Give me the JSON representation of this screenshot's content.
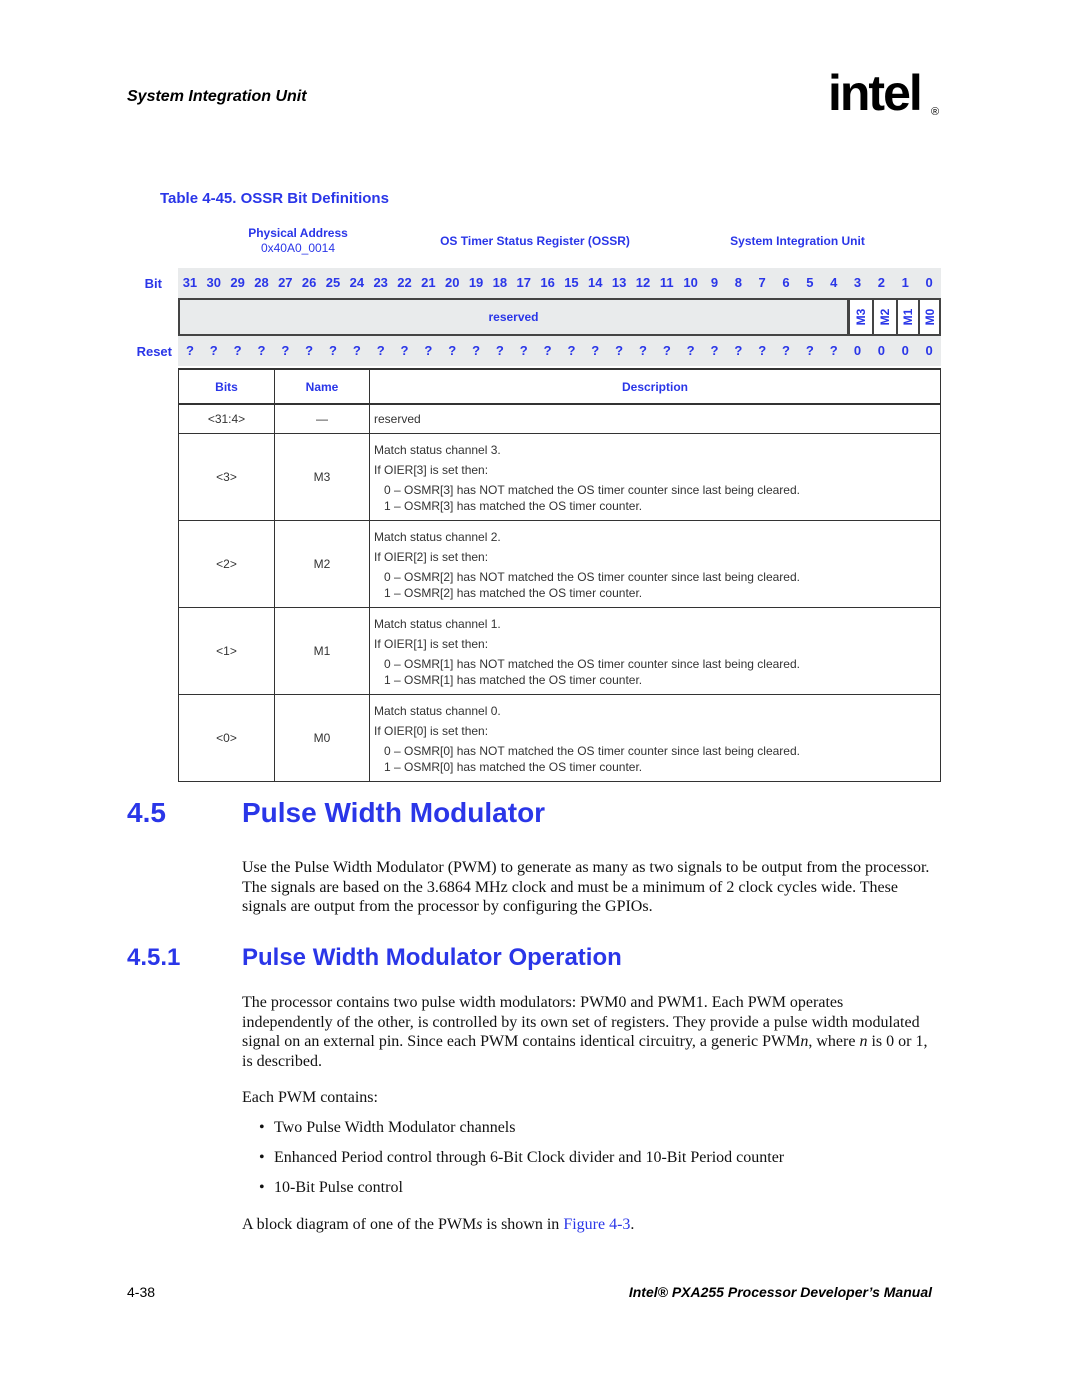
{
  "header": {
    "running_title": "System Integration Unit",
    "logo_text": "intel",
    "logo_mark": "®"
  },
  "table": {
    "caption": "Table 4-45. OSSR Bit Definitions",
    "physical_address_label": "Physical Address",
    "physical_address": "0x40A0_0014",
    "register_name": "OS Timer Status Register (OSSR)",
    "unit_name": "System Integration Unit",
    "bit_label": "Bit",
    "reset_label": "Reset",
    "bits": [
      "31",
      "30",
      "29",
      "28",
      "27",
      "26",
      "25",
      "24",
      "23",
      "22",
      "21",
      "20",
      "19",
      "18",
      "17",
      "16",
      "15",
      "14",
      "13",
      "12",
      "11",
      "10",
      "9",
      "8",
      "7",
      "6",
      "5",
      "4",
      "3",
      "2",
      "1",
      "0"
    ],
    "fields": {
      "reserved": "reserved",
      "m3": "M3",
      "m2": "M2",
      "m1": "M1",
      "m0": "M0"
    },
    "reset_values": [
      "?",
      "?",
      "?",
      "?",
      "?",
      "?",
      "?",
      "?",
      "?",
      "?",
      "?",
      "?",
      "?",
      "?",
      "?",
      "?",
      "?",
      "?",
      "?",
      "?",
      "?",
      "?",
      "?",
      "?",
      "?",
      "?",
      "?",
      "?",
      "0",
      "0",
      "0",
      "0"
    ],
    "columns": [
      "Bits",
      "Name",
      "Description"
    ],
    "rows": [
      {
        "bits": "<31:4>",
        "name": "—",
        "lines": [
          "reserved"
        ]
      },
      {
        "bits": "<3>",
        "name": "M3",
        "lines": [
          "Match status channel 3.",
          "If OIER[3] is set then:",
          "0 – OSMR[3] has NOT matched the OS timer counter since last being cleared.",
          "1 – OSMR[3] has matched the OS timer counter."
        ]
      },
      {
        "bits": "<2>",
        "name": "M2",
        "lines": [
          "Match status channel 2.",
          "If OIER[2] is set then:",
          "0 – OSMR[2] has NOT matched the OS timer counter since last being cleared.",
          "1 – OSMR[2] has matched the OS timer counter."
        ]
      },
      {
        "bits": "<1>",
        "name": "M1",
        "lines": [
          "Match status channel 1.",
          "If OIER[1] is set then:",
          "0 – OSMR[1] has NOT matched the OS timer counter since last being cleared.",
          "1 – OSMR[1] has matched the OS timer counter."
        ]
      },
      {
        "bits": "<0>",
        "name": "M0",
        "lines": [
          "Match status channel 0.",
          "If OIER[0] is set then:",
          "0 – OSMR[0] has NOT matched the OS timer counter since last being cleared.",
          "1 – OSMR[0] has matched the OS timer counter."
        ]
      }
    ]
  },
  "section": {
    "number": "4.5",
    "title": "Pulse Width Modulator",
    "paragraph": "Use the Pulse Width Modulator (PWM) to generate as many as two signals to be output from the processor. The signals are based on the 3.6864 MHz clock and must be a minimum of 2 clock cycles wide. These signals are output from the processor by configuring the GPIOs."
  },
  "subsection": {
    "number": "4.5.1",
    "title": "Pulse Width Modulator Operation",
    "paragraph_parts": {
      "a": "The processor contains two pulse width modulators: PWM0 and PWM1. Each PWM operates independently of the other, is controlled by its own set of registers. They provide a pulse width modulated signal on an external pin. Since each PWM contains identical circuitry, a generic PWM",
      "n1": "n",
      "b": ", where ",
      "n2": "n",
      "c": " is 0 or 1, is described."
    },
    "contains_intro": "Each PWM contains:",
    "bullets": [
      "Two Pulse Width Modulator channels",
      "Enhanced Period control through 6-Bit Clock divider and 10-Bit Period counter",
      "10-Bit Pulse control"
    ],
    "diagram_ref": {
      "before": "A block diagram of one of the PWM",
      "italic": "s",
      "middle": " is shown in ",
      "link": "Figure 4-3",
      "after": "."
    }
  },
  "footer": {
    "page_number": "4-38",
    "manual_title": "Intel® PXA255 Processor Developer’s Manual"
  }
}
